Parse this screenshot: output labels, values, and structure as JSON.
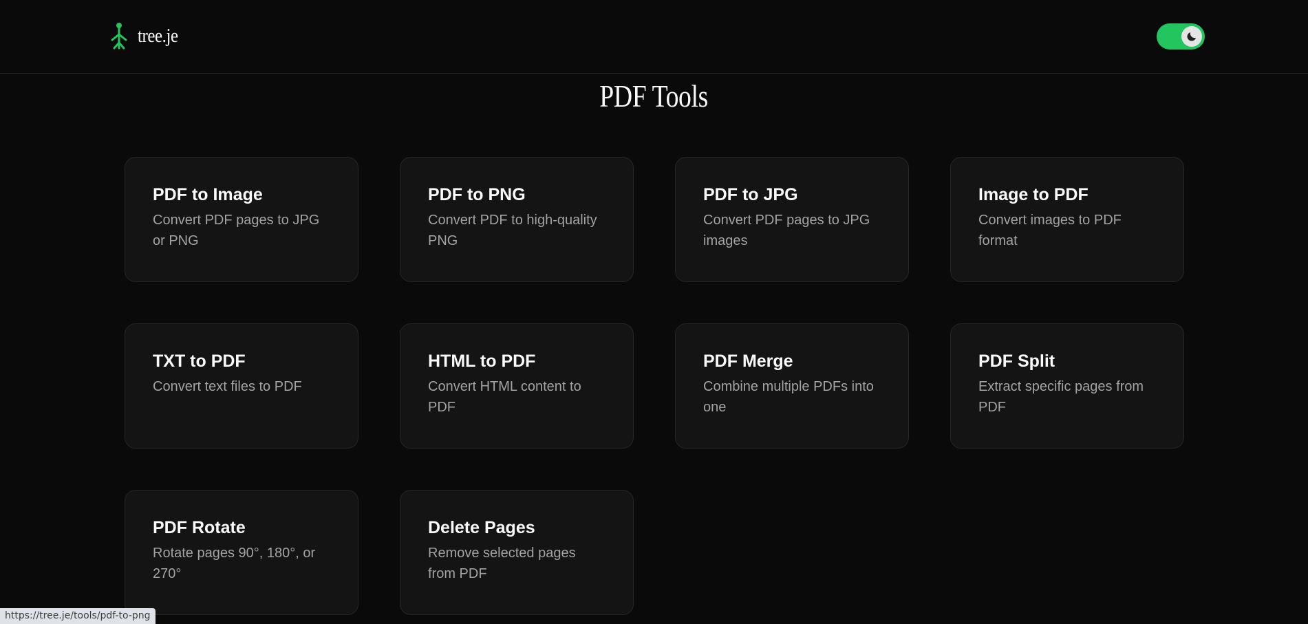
{
  "header": {
    "brand_name": "tree.je",
    "logo_icon": "tree-person-icon",
    "accent_color": "#22c55e",
    "theme_toggle": {
      "icon": "moon-icon",
      "state": "dark",
      "on": true
    }
  },
  "main": {
    "title": "PDF Tools",
    "tools": [
      {
        "title": "PDF to Image",
        "description": "Convert PDF pages to JPG or PNG"
      },
      {
        "title": "PDF to PNG",
        "description": "Convert PDF to high-quality PNG"
      },
      {
        "title": "PDF to JPG",
        "description": "Convert PDF pages to JPG images"
      },
      {
        "title": "Image to PDF",
        "description": "Convert images to PDF format"
      },
      {
        "title": "TXT to PDF",
        "description": "Convert text files to PDF"
      },
      {
        "title": "HTML to PDF",
        "description": "Convert HTML content to PDF"
      },
      {
        "title": "PDF Merge",
        "description": "Combine multiple PDFs into one"
      },
      {
        "title": "PDF Split",
        "description": "Extract specific pages from PDF"
      },
      {
        "title": "PDF Rotate",
        "description": "Rotate pages 90°, 180°, or 270°"
      },
      {
        "title": "Delete Pages",
        "description": "Remove selected pages from PDF"
      }
    ]
  },
  "status_bar": {
    "hover_url": "https://tree.je/tools/pdf-to-png"
  }
}
